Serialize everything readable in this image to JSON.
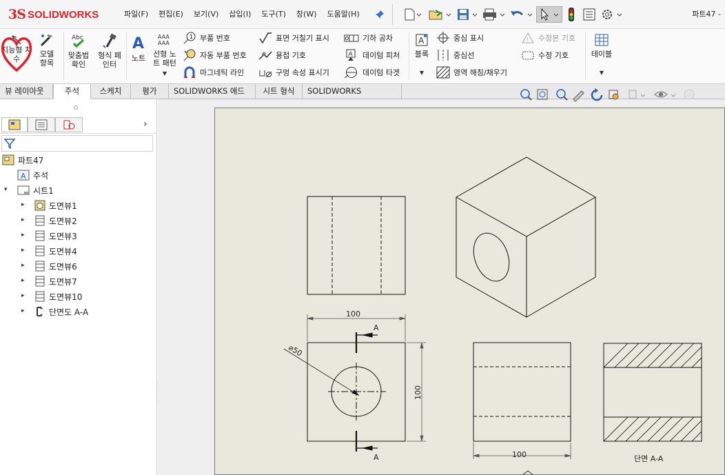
{
  "app": {
    "brand_prefix": "3S",
    "brand_name": "SOLIDWORKS",
    "doc_title": "파트47 -"
  },
  "menu": [
    "파일(F)",
    "편집(E)",
    "보기(V)",
    "삽입(I)",
    "도구(T)",
    "창(W)",
    "도움말(H)"
  ],
  "ribbon": {
    "smart_dim": "지능형 치수",
    "model_items": "모델 항목",
    "spell_check": "맞춤법 확인",
    "format_painter": "형식 페인터",
    "note": "노트",
    "linear_note_pattern": "선형 노트 패턴",
    "balloon": "부품 번호",
    "auto_balloon": "자동 부품 번호",
    "magnetic_line": "마그네틱 라인",
    "surface_finish": "표면 거칠기 표시",
    "weld_symbol": "용접 기호",
    "hole_callout": "구멍 속성 표시기",
    "gtol": "기하 공차",
    "datum_feature": "데이텀 피처",
    "datum_target": "데이텀 타겟",
    "block": "블록",
    "center_mark": "중심 표시",
    "centerline": "중심선",
    "area_hatch": "영역 해칭/채우기",
    "revision_symbol": "수정본 기호",
    "revision_cloud": "수정 기호",
    "tables": "테이블"
  },
  "tabs": [
    "뷰 레이아웃",
    "주석",
    "스케치",
    "평가",
    "SOLIDWORKS 애드인",
    "시트 형식",
    "SOLIDWORKS Inspection"
  ],
  "active_tab": "주석",
  "tree": {
    "root": "파트47",
    "annotations": "주석",
    "sheet": "시트1",
    "views": [
      "도면뷰1",
      "도면뷰2",
      "도면뷰3",
      "도면뷰4",
      "도면뷰6",
      "도면뷰7",
      "도면뷰10"
    ],
    "section": "단면도 A-A"
  },
  "drawing": {
    "dim_top_width": "100",
    "dim_height": "100",
    "dim_diameter": "⌀50",
    "dim_right_width": "100",
    "section_letter_top": "A",
    "section_letter_bottom": "A",
    "section_label": "단면 A-A"
  },
  "colors": {
    "accent": "#d8262d",
    "sheet": "#e9e8dc",
    "highlight_heart": "#e0202c"
  }
}
